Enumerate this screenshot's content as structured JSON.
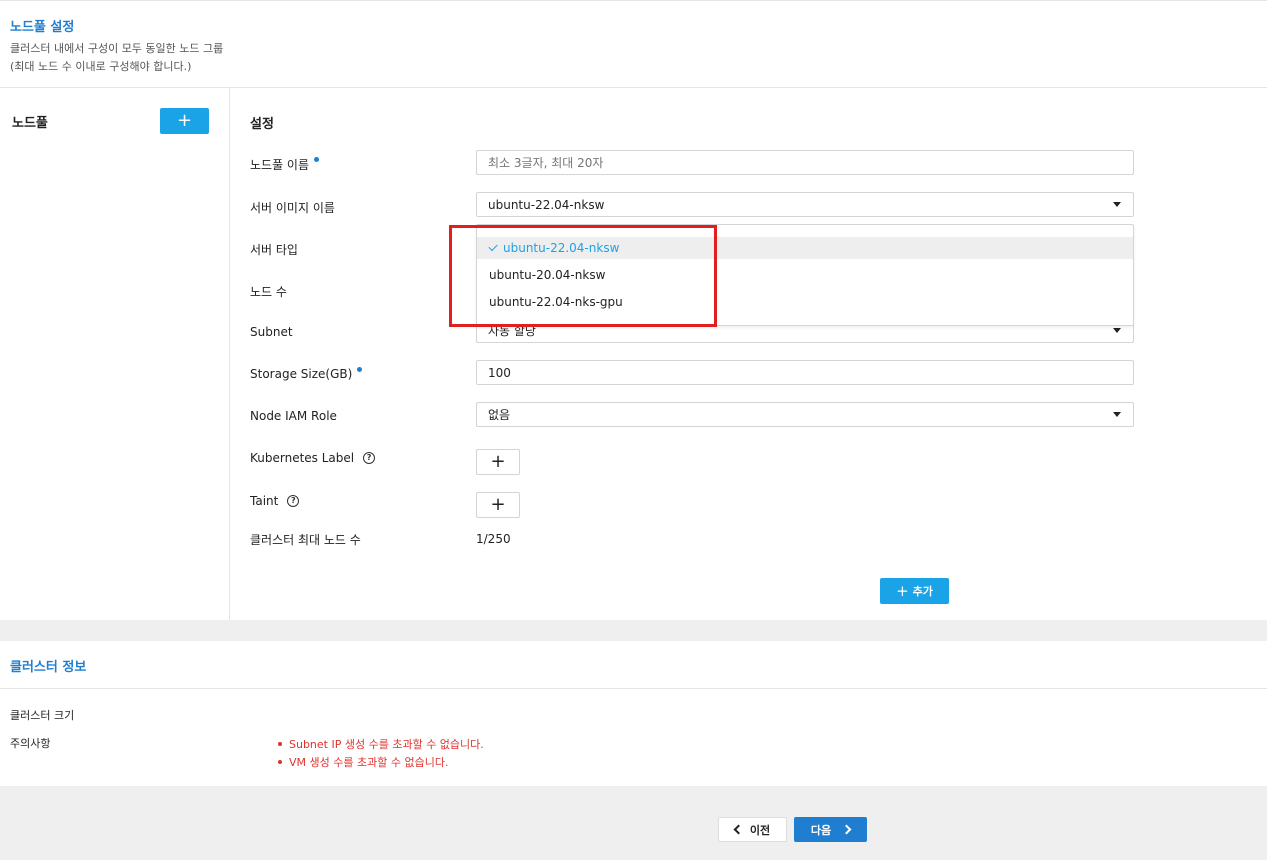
{
  "header": {
    "title": "노드풀 설정",
    "desc_line1": "클러스터 내에서 구성이 모두 동일한 노드 그룹",
    "desc_line2": "(최대 노드 수 이내로 구성해야 합니다.)"
  },
  "nodepool": {
    "label": "노드풀",
    "add_label": "+"
  },
  "settings": {
    "title": "설정",
    "fields": {
      "nodepool_name": {
        "label": "노드풀 이름",
        "placeholder": "최소 3글자, 최대 20자"
      },
      "server_image": {
        "label": "서버 이미지 이름",
        "value": "ubuntu-22.04-nksw"
      },
      "server_type": {
        "label": "서버 타입"
      },
      "node_count": {
        "label": "노드 수"
      },
      "subnet": {
        "label": "Subnet",
        "value": "자동 할당"
      },
      "storage_size": {
        "label": "Storage Size(GB)",
        "value": "100"
      },
      "node_iam_role": {
        "label": "Node IAM Role",
        "value": "없음"
      },
      "kubernetes_label": {
        "label": "Kubernetes Label",
        "add_label": "+"
      },
      "taint": {
        "label": "Taint",
        "add_label": "+"
      },
      "cluster_max_nodes": {
        "label": "클러스터 최대 노드 수",
        "value": "1/250"
      }
    },
    "add_button": {
      "plus": "+",
      "label": "추가"
    },
    "help_glyph": "?"
  },
  "image_dropdown": {
    "options": [
      {
        "label": "ubuntu-22.04-nksw",
        "selected": true
      },
      {
        "label": "ubuntu-20.04-nksw",
        "selected": false
      },
      {
        "label": "ubuntu-22.04-nks-gpu",
        "selected": false
      }
    ]
  },
  "cluster_info": {
    "title": "클러스터 정보",
    "size_label": "클러스터 크기",
    "notes_label": "주의사항",
    "warnings": [
      "Subnet IP 생성 수를 초과할 수 없습니다.",
      "VM 생성 수를 초과할 수 없습니다."
    ]
  },
  "footer": {
    "prev_label": "이전",
    "next_label": "다음"
  },
  "colors": {
    "accent": "#1aa3e6",
    "title_blue": "#1f7ed0",
    "warning": "#e0322d",
    "highlight_box": "#e02020"
  }
}
